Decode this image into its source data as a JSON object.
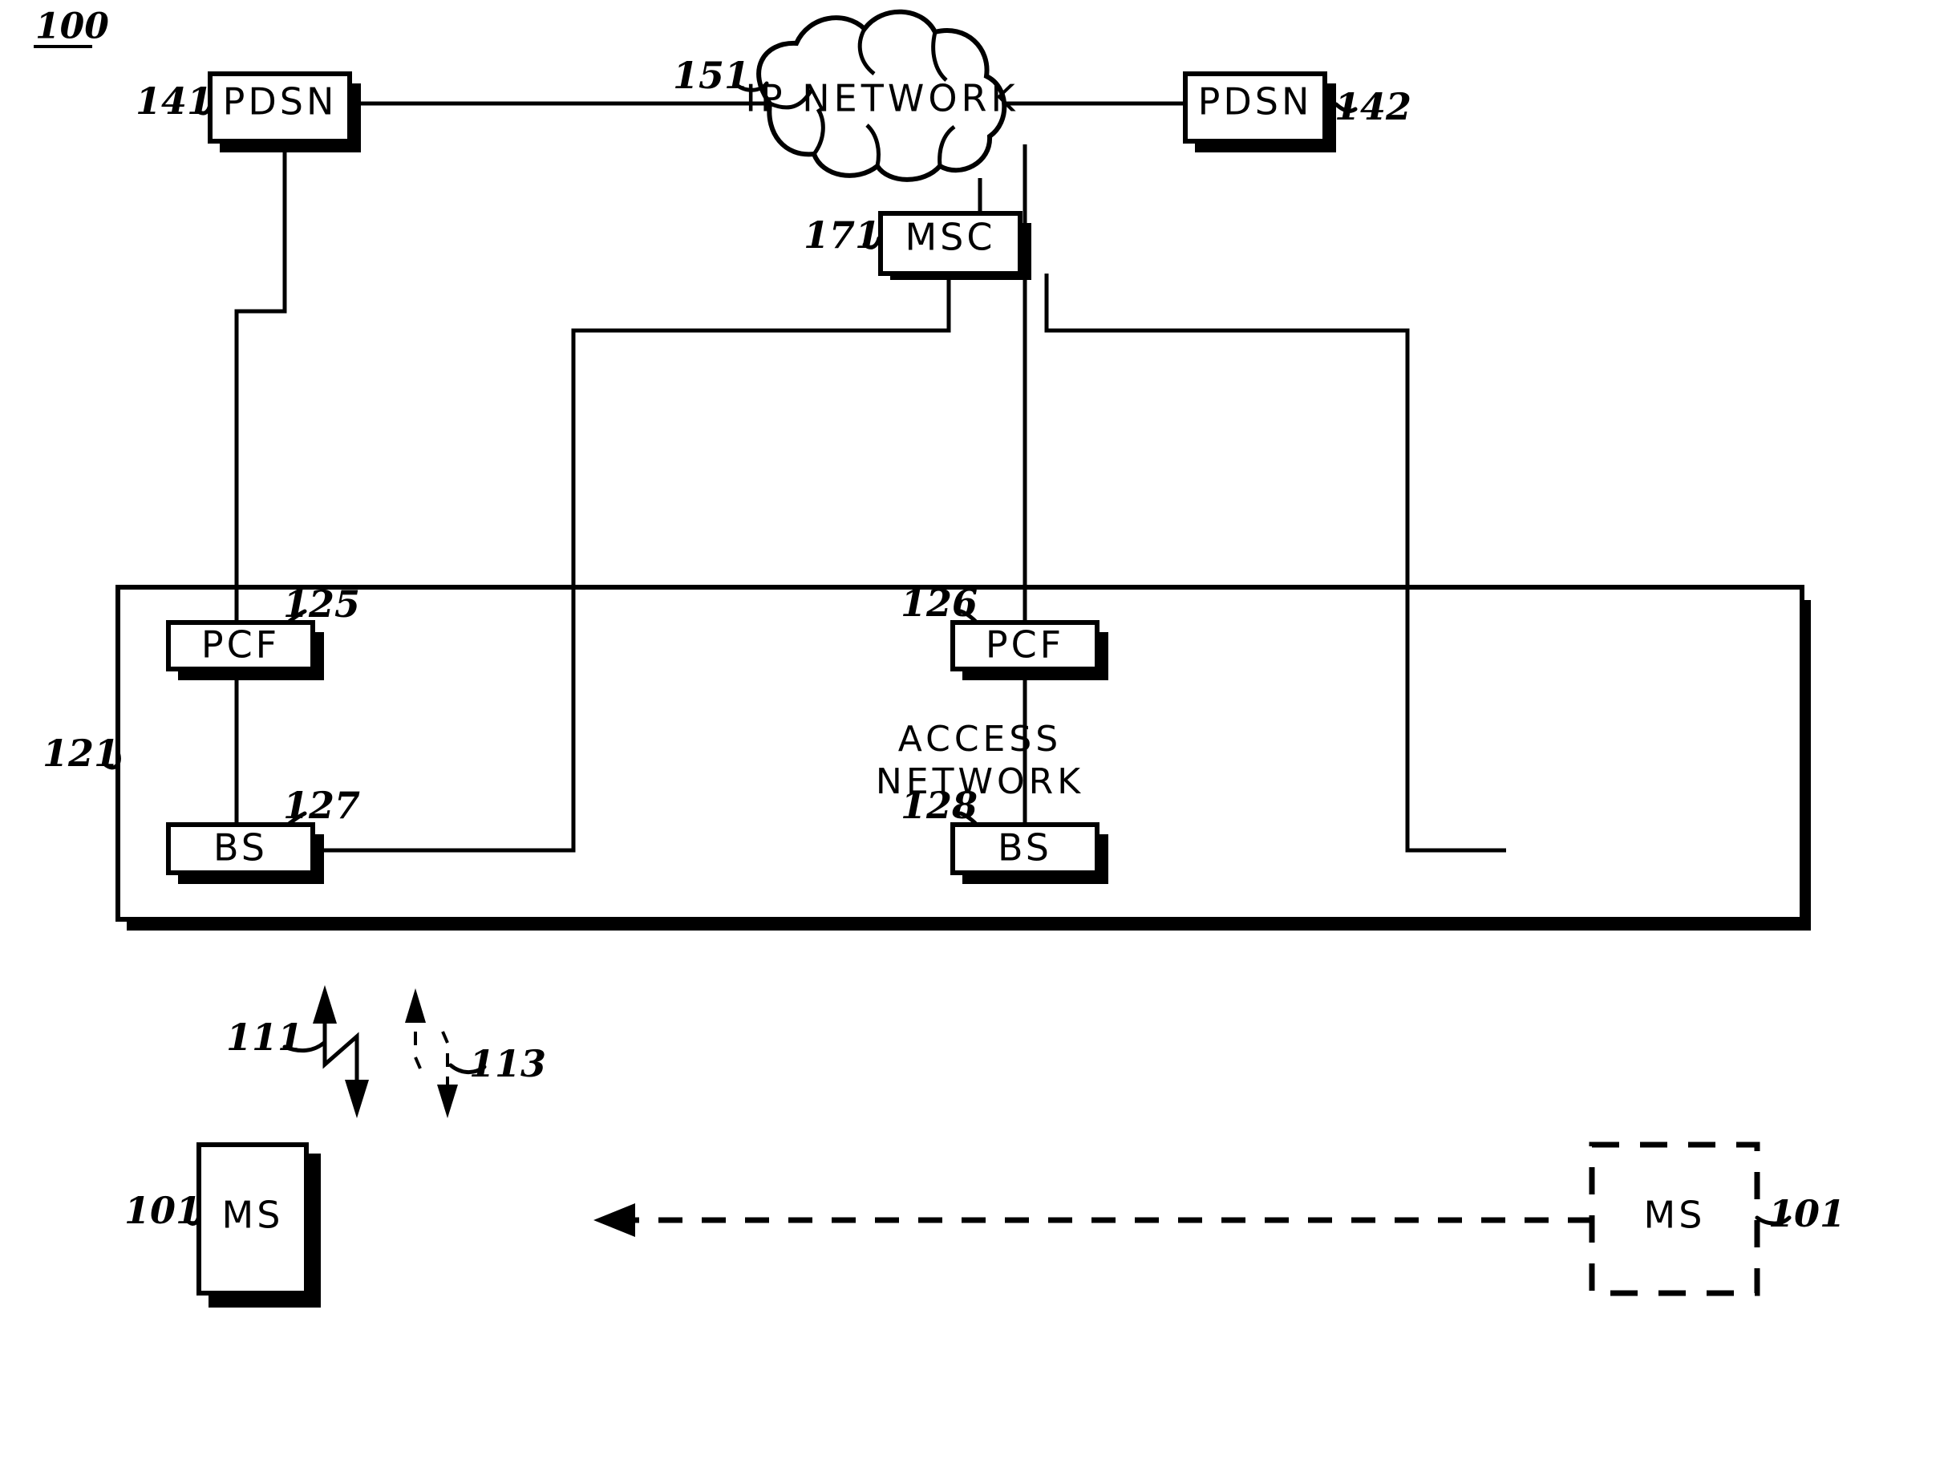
{
  "figure": {
    "number": "100",
    "title_underline": true
  },
  "nodes": {
    "pdsn_left": {
      "label": "PDSN",
      "ref": "141"
    },
    "pdsn_right": {
      "label": "PDSN",
      "ref": "142"
    },
    "ip_network": {
      "label": "IP NETWORK",
      "ref": "151"
    },
    "msc": {
      "label": "MSC",
      "ref": "171"
    },
    "access_network": {
      "label_line1": "ACCESS",
      "label_line2": "NETWORK",
      "ref": "121"
    },
    "pcf_left": {
      "label": "PCF",
      "ref": "125"
    },
    "pcf_right": {
      "label": "PCF",
      "ref": "126"
    },
    "bs_left": {
      "label": "BS",
      "ref": "127"
    },
    "bs_right": {
      "label": "BS",
      "ref": "128"
    },
    "ms_left": {
      "label": "MS",
      "ref": "101"
    },
    "ms_right": {
      "label": "MS",
      "ref": "101"
    }
  },
  "signals": {
    "solid_link": {
      "ref": "111"
    },
    "dashed_link": {
      "ref": "113"
    }
  },
  "colors": {
    "line": "#000000",
    "fill": "#ffffff",
    "shadow": "#000000"
  }
}
